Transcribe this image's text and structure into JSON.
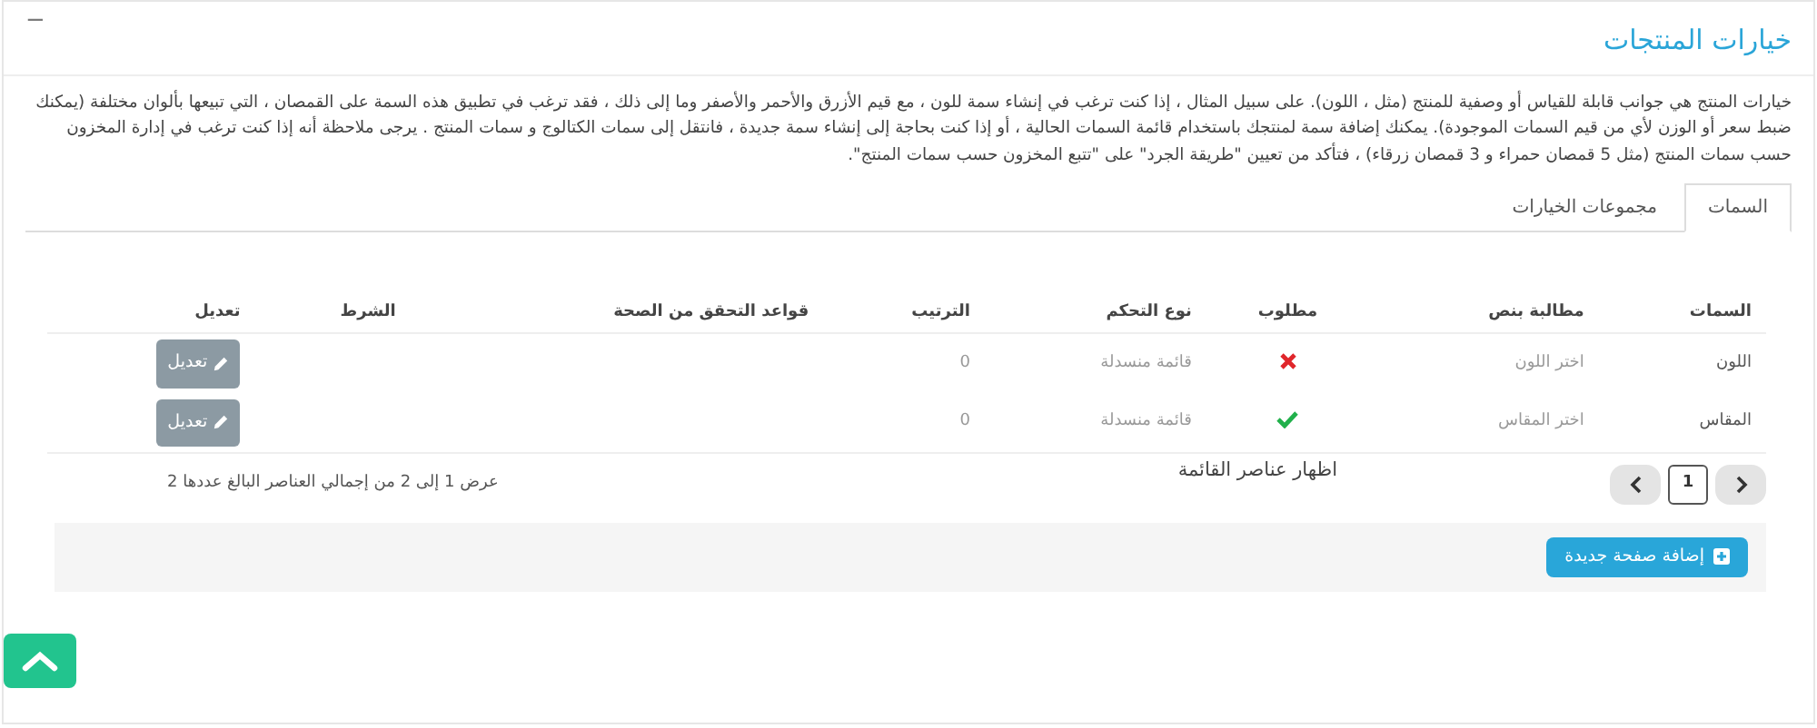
{
  "panel": {
    "title": "خيارات المنتجات",
    "collapse": "−"
  },
  "description": "خيارات المنتج هي جوانب قابلة للقياس أو وصفية للمنتج (مثل ، اللون). على سبيل المثال ، إذا كنت ترغب في إنشاء سمة للون ، مع قيم الأزرق والأحمر والأصفر وما إلى ذلك ، فقد ترغب في تطبيق هذه السمة على القمصان ، التي تبيعها بألوان مختلفة (يمكنك ضبط سعر أو الوزن لأي من قيم السمات الموجودة). يمكنك إضافة سمة لمنتجك باستخدام قائمة السمات الحالية ، أو إذا كنت بحاجة إلى إنشاء سمة جديدة ، فانتقل إلى سمات الكتالوج و سمات المنتج . يرجى ملاحظة أنه إذا كنت ترغب في إدارة المخزون حسب سمات المنتج (مثل 5 قمصان حمراء و 3 قمصان زرقاء) ، فتأكد من تعيين \"طريقة الجرد\" على \"تتبع المخزون حسب سمات المنتج\".",
  "tabs": [
    {
      "label": "السمات",
      "selected": true
    },
    {
      "label": "مجموعات الخيارات",
      "selected": false
    }
  ],
  "table": {
    "columns": [
      "السمات",
      "مطالبة بنص",
      "مطلوب",
      "نوع التحكم",
      "الترتيب",
      "قواعد التحقق من الصحة",
      "الشرط",
      "تعديل"
    ],
    "rows": [
      {
        "attribute": "اللون",
        "prompt": "اختر اللون",
        "required": false,
        "control_type": "قائمة منسدلة",
        "order": "0",
        "edit": "تعديل"
      },
      {
        "attribute": "المقاس",
        "prompt": "اختر المقاس",
        "required": true,
        "control_type": "قائمة منسدلة",
        "order": "0",
        "edit": "تعديل"
      }
    ]
  },
  "pagination": {
    "pages": [
      {
        "label": "1",
        "selected": true
      }
    ]
  },
  "show_items_label": "اظهار عناصر القائمة",
  "summary": "عرض 1 إلى 2 من إجمالي العناصر البالغ عددها 2",
  "add_button": "إضافة صفحة جديدة"
}
